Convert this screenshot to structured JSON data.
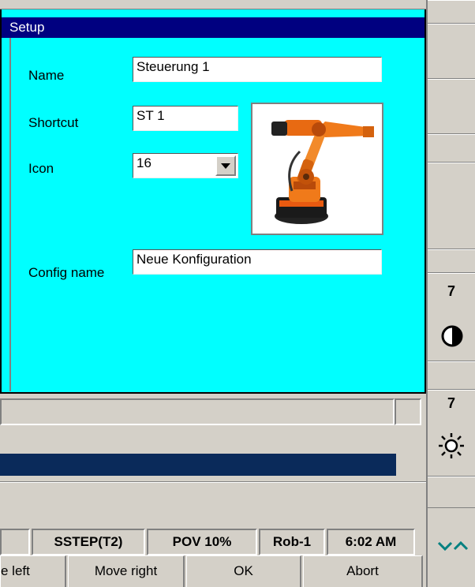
{
  "dialog": {
    "title": "Setup",
    "name_label": "Name",
    "name_value": "Steuerung 1",
    "shortcut_label": "Shortcut",
    "shortcut_value": "ST 1",
    "icon_label": "Icon",
    "icon_value": "16",
    "config_label": "Config name",
    "config_value": "Neue Konfiguration"
  },
  "right_panel": {
    "contrast_value": "7",
    "brightness_value": "7"
  },
  "status_bar": [
    "SSTEP(T2)",
    "POV 10%",
    "Rob-1",
    "6:02 AM"
  ],
  "softkeys": [
    "e left",
    "Move right",
    "OK",
    "Abort"
  ],
  "colors": {
    "dialog_bg": "#00ffff",
    "title_bar": "#000080",
    "progress_bar": "#0a2a5a"
  }
}
